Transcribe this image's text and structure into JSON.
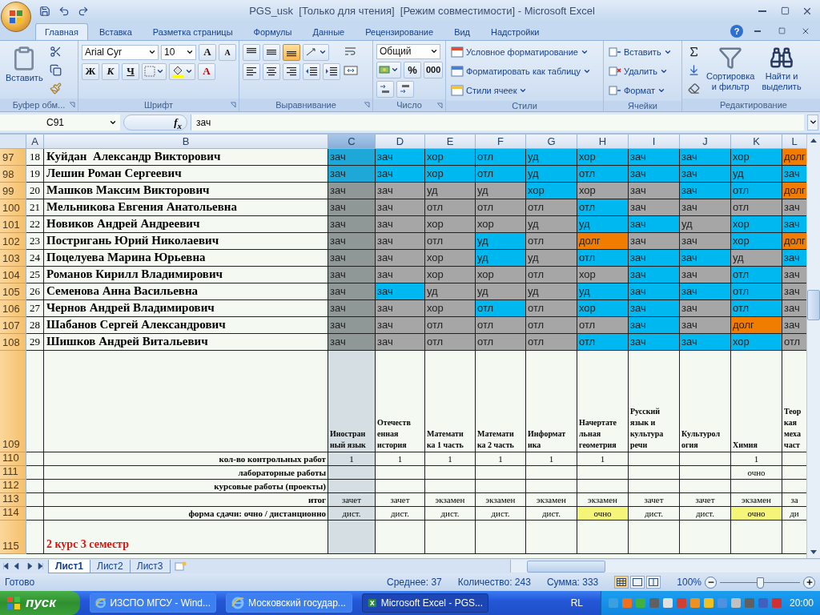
{
  "window": {
    "title": "PGS_usk  [Только для чтения]  [Режим совместимости] - Microsoft Excel",
    "help": "?"
  },
  "ribbon_tabs": [
    {
      "label": "Главная",
      "selected": true
    },
    {
      "label": "Вставка",
      "selected": false
    },
    {
      "label": "Разметка страницы",
      "selected": false
    },
    {
      "label": "Формулы",
      "selected": false
    },
    {
      "label": "Данные",
      "selected": false
    },
    {
      "label": "Рецензирование",
      "selected": false
    },
    {
      "label": "Вид",
      "selected": false
    },
    {
      "label": "Надстройки",
      "selected": false
    }
  ],
  "clipboard": {
    "paste": "Вставить",
    "group": "Буфер обм..."
  },
  "font": {
    "name": "Arial Cyr",
    "size": "10",
    "grow": "A",
    "shrink": "A",
    "bold": "Ж",
    "italic": "К",
    "underline": "Ч",
    "color_letter": "A",
    "group": "Шрифт"
  },
  "alignment": {
    "vertical": [
      {
        "selected": false
      },
      {
        "selected": false
      },
      {
        "selected": true
      }
    ],
    "group": "Выравнивание"
  },
  "number": {
    "format": "Общий",
    "percent": "%",
    "thousands": "000",
    "group": "Число"
  },
  "styles": {
    "items": [
      "Условное форматирование",
      "Форматировать как таблицу",
      "Стили ячеек"
    ],
    "group": "Стили"
  },
  "cells": {
    "items": [
      "Вставить",
      "Удалить",
      "Формат"
    ],
    "group": "Ячейки"
  },
  "editing": {
    "sort": "Сортировка\nи фильтр",
    "find": "Найти и\nвыделить",
    "group": "Редактирование"
  },
  "formula_bar": {
    "name_box": "C91",
    "fx": "f$_{x}$",
    "formula": "зач"
  },
  "columns": [
    {
      "label": "A",
      "selected": false
    },
    {
      "label": "B",
      "selected": false
    },
    {
      "label": "C",
      "selected": true
    },
    {
      "label": "D",
      "selected": false
    },
    {
      "label": "E",
      "selected": false
    },
    {
      "label": "F",
      "selected": false
    },
    {
      "label": "G",
      "selected": false
    },
    {
      "label": "H",
      "selected": false
    },
    {
      "label": "I",
      "selected": false
    },
    {
      "label": "J",
      "selected": false
    },
    {
      "label": "K",
      "selected": false
    },
    {
      "label": "L",
      "selected": false
    }
  ],
  "student_rows": [
    {
      "row": "97",
      "num": "18",
      "name": "Куйдан  Александр Викторович",
      "cells": [
        {
          "text": "зач",
          "color": "#1ea8d8"
        },
        {
          "text": "зач",
          "color": "#00b8f0"
        },
        {
          "text": "хор",
          "color": "#00b8f0"
        },
        {
          "text": "отл",
          "color": "#00b8f0"
        },
        {
          "text": "уд",
          "color": "#00b8f0"
        },
        {
          "text": "хор",
          "color": "#00b8f0"
        },
        {
          "text": "зач",
          "color": "#00b8f0"
        },
        {
          "text": "зач",
          "color": "#00b8f0"
        },
        {
          "text": "хор",
          "color": "#00b8f0"
        },
        {
          "text": "долг",
          "color": "#f07c00"
        }
      ]
    },
    {
      "row": "98",
      "num": "19",
      "name": "Лешин Роман Сергеевич",
      "cells": [
        {
          "text": "зач",
          "color": "#1ea8d8"
        },
        {
          "text": "зач",
          "color": "#00b8f0"
        },
        {
          "text": "хор",
          "color": "#00b8f0"
        },
        {
          "text": "отл",
          "color": "#00b8f0"
        },
        {
          "text": "уд",
          "color": "#00b8f0"
        },
        {
          "text": "отл",
          "color": "#00b8f0"
        },
        {
          "text": "зач",
          "color": "#00b8f0"
        },
        {
          "text": "зач",
          "color": "#00b8f0"
        },
        {
          "text": "уд",
          "color": "#00b8f0"
        },
        {
          "text": "зач",
          "color": "#00b8f0"
        }
      ]
    },
    {
      "row": "99",
      "num": "20",
      "name": "Машков Максим Викторович",
      "cells": [
        {
          "text": "зач",
          "color": "#8f9797"
        },
        {
          "text": "зач",
          "color": "#a6a6a6"
        },
        {
          "text": "уд",
          "color": "#a6a6a6"
        },
        {
          "text": "уд",
          "color": "#a6a6a6"
        },
        {
          "text": "хор",
          "color": "#00b8f0"
        },
        {
          "text": "хор",
          "color": "#a6a6a6"
        },
        {
          "text": "зач",
          "color": "#a6a6a6"
        },
        {
          "text": "зач",
          "color": "#00b8f0"
        },
        {
          "text": "отл",
          "color": "#00b8f0"
        },
        {
          "text": "долг",
          "color": "#f07c00"
        }
      ]
    },
    {
      "row": "100",
      "num": "21",
      "name": "Мельникова Евгения Анатольевна",
      "cells": [
        {
          "text": "зач",
          "color": "#8f9797"
        },
        {
          "text": "зач",
          "color": "#a6a6a6"
        },
        {
          "text": "отл",
          "color": "#a6a6a6"
        },
        {
          "text": "отл",
          "color": "#a6a6a6"
        },
        {
          "text": "отл",
          "color": "#a6a6a6"
        },
        {
          "text": "отл",
          "color": "#00b8f0"
        },
        {
          "text": "зач",
          "color": "#a6a6a6"
        },
        {
          "text": "зач",
          "color": "#a6a6a6"
        },
        {
          "text": "отл",
          "color": "#a6a6a6"
        },
        {
          "text": "зач",
          "color": "#a6a6a6"
        }
      ]
    },
    {
      "row": "101",
      "num": "22",
      "name": "Новиков Андрей Андреевич",
      "cells": [
        {
          "text": "зач",
          "color": "#8f9797"
        },
        {
          "text": "зач",
          "color": "#a6a6a6"
        },
        {
          "text": "хор",
          "color": "#a6a6a6"
        },
        {
          "text": "хор",
          "color": "#a6a6a6"
        },
        {
          "text": "уд",
          "color": "#a6a6a6"
        },
        {
          "text": "уд",
          "color": "#00b8f0"
        },
        {
          "text": "зач",
          "color": "#00b8f0"
        },
        {
          "text": "уд",
          "color": "#a6a6a6"
        },
        {
          "text": "хор",
          "color": "#00b8f0"
        },
        {
          "text": "зач",
          "color": "#00b8f0"
        }
      ]
    },
    {
      "row": "102",
      "num": "23",
      "name": "Постригань Юрий Николаевич",
      "cells": [
        {
          "text": "зач",
          "color": "#8f9797"
        },
        {
          "text": "зач",
          "color": "#a6a6a6"
        },
        {
          "text": "отл",
          "color": "#a6a6a6"
        },
        {
          "text": "уд",
          "color": "#00b8f0"
        },
        {
          "text": "отл",
          "color": "#a6a6a6"
        },
        {
          "text": "долг",
          "color": "#f07c00"
        },
        {
          "text": "зач",
          "color": "#a6a6a6"
        },
        {
          "text": "зач",
          "color": "#a6a6a6"
        },
        {
          "text": "хор",
          "color": "#00b8f0"
        },
        {
          "text": "долг",
          "color": "#f07c00"
        }
      ]
    },
    {
      "row": "103",
      "num": "24",
      "name": "Поцелуева Марина Юрьевна",
      "cells": [
        {
          "text": "зач",
          "color": "#8f9797"
        },
        {
          "text": "зач",
          "color": "#a6a6a6"
        },
        {
          "text": "хор",
          "color": "#a6a6a6"
        },
        {
          "text": "уд",
          "color": "#00b8f0"
        },
        {
          "text": "уд",
          "color": "#a6a6a6"
        },
        {
          "text": "отл",
          "color": "#00b8f0"
        },
        {
          "text": "зач",
          "color": "#00b8f0"
        },
        {
          "text": "зач",
          "color": "#00b8f0"
        },
        {
          "text": "уд",
          "color": "#a6a6a6"
        },
        {
          "text": "зач",
          "color": "#00b8f0"
        }
      ]
    },
    {
      "row": "104",
      "num": "25",
      "name": "Романов Кирилл Владимирович",
      "cells": [
        {
          "text": "зач",
          "color": "#8f9797"
        },
        {
          "text": "зач",
          "color": "#a6a6a6"
        },
        {
          "text": "хор",
          "color": "#a6a6a6"
        },
        {
          "text": "хор",
          "color": "#a6a6a6"
        },
        {
          "text": "отл",
          "color": "#a6a6a6"
        },
        {
          "text": "хор",
          "color": "#a6a6a6"
        },
        {
          "text": "зач",
          "color": "#00b8f0"
        },
        {
          "text": "зач",
          "color": "#a6a6a6"
        },
        {
          "text": "отл",
          "color": "#00b8f0"
        },
        {
          "text": "зач",
          "color": "#a6a6a6"
        }
      ]
    },
    {
      "row": "105",
      "num": "26",
      "name": "Семенова Анна Васильевна",
      "cells": [
        {
          "text": "зач",
          "color": "#8f9797"
        },
        {
          "text": "зач",
          "color": "#00b8f0"
        },
        {
          "text": "уд",
          "color": "#a6a6a6"
        },
        {
          "text": "уд",
          "color": "#a6a6a6"
        },
        {
          "text": "уд",
          "color": "#a6a6a6"
        },
        {
          "text": "уд",
          "color": "#00b8f0"
        },
        {
          "text": "зач",
          "color": "#00b8f0"
        },
        {
          "text": "зач",
          "color": "#00b8f0"
        },
        {
          "text": "отл",
          "color": "#00b8f0"
        },
        {
          "text": "зач",
          "color": "#a6a6a6"
        }
      ]
    },
    {
      "row": "106",
      "num": "27",
      "name": "Чернов Андрей Владимирович",
      "cells": [
        {
          "text": "зач",
          "color": "#8f9797"
        },
        {
          "text": "зач",
          "color": "#a6a6a6"
        },
        {
          "text": "хор",
          "color": "#a6a6a6"
        },
        {
          "text": "отл",
          "color": "#00b8f0"
        },
        {
          "text": "отл",
          "color": "#a6a6a6"
        },
        {
          "text": "хор",
          "color": "#00b8f0"
        },
        {
          "text": "зач",
          "color": "#00b8f0"
        },
        {
          "text": "зач",
          "color": "#a6a6a6"
        },
        {
          "text": "отл",
          "color": "#00b8f0"
        },
        {
          "text": "зач",
          "color": "#a6a6a6"
        }
      ]
    },
    {
      "row": "107",
      "num": "28",
      "name": "Шабанов Сергей Александрович",
      "cells": [
        {
          "text": "зач",
          "color": "#8f9797"
        },
        {
          "text": "зач",
          "color": "#a6a6a6"
        },
        {
          "text": "отл",
          "color": "#a6a6a6"
        },
        {
          "text": "отл",
          "color": "#a6a6a6"
        },
        {
          "text": "отл",
          "color": "#a6a6a6"
        },
        {
          "text": "отл",
          "color": "#a6a6a6"
        },
        {
          "text": "зач",
          "color": "#00b8f0"
        },
        {
          "text": "зач",
          "color": "#a6a6a6"
        },
        {
          "text": "долг",
          "color": "#f07c00"
        },
        {
          "text": "зач",
          "color": "#a6a6a6"
        }
      ]
    },
    {
      "row": "108",
      "num": "29",
      "name": "Шишков Андрей Витальевич",
      "cells": [
        {
          "text": "зач",
          "color": "#8f9797"
        },
        {
          "text": "зач",
          "color": "#a6a6a6"
        },
        {
          "text": "отл",
          "color": "#a6a6a6"
        },
        {
          "text": "отл",
          "color": "#a6a6a6"
        },
        {
          "text": "отл",
          "color": "#a6a6a6"
        },
        {
          "text": "отл",
          "color": "#00b8f0"
        },
        {
          "text": "зач",
          "color": "#00b8f0"
        },
        {
          "text": "зач",
          "color": "#00b8f0"
        },
        {
          "text": "хор",
          "color": "#00b8f0"
        },
        {
          "text": "отл",
          "color": "#a6a6a6"
        }
      ]
    }
  ],
  "subject_row": {
    "row": "109",
    "subjects": [
      "Иностран\nный язык",
      "Отечеств\nенная\nистория",
      "Математи\nка 1 часть",
      "Математи\nка 2 часть",
      "Информат\nика",
      "Начертате\nльная\nгеометрия",
      "Русский\nязык и\nкультура\nречи",
      "Культурол\nогия",
      "Химия",
      "Теор\nкая\nмеха\nчаст"
    ]
  },
  "summary_rows": [
    {
      "row": "110",
      "label": "кол-во контрольных работ",
      "values": [
        {
          "kind": "text",
          "text": "1"
        },
        {
          "kind": "text",
          "text": "1"
        },
        {
          "kind": "text",
          "text": "1"
        },
        {
          "kind": "text",
          "text": "1"
        },
        {
          "kind": "text",
          "text": "1"
        },
        {
          "kind": "text",
          "text": "1"
        },
        {
          "kind": "blank"
        },
        {
          "kind": "blank"
        },
        {
          "kind": "text",
          "text": "1"
        },
        {
          "kind": "blank"
        }
      ]
    },
    {
      "row": "111",
      "label": "лабораторные работы",
      "values": [
        {
          "kind": "blank"
        },
        {
          "kind": "blank"
        },
        {
          "kind": "blank"
        },
        {
          "kind": "blank"
        },
        {
          "kind": "blank"
        },
        {
          "kind": "blank"
        },
        {
          "kind": "blank"
        },
        {
          "kind": "blank"
        },
        {
          "kind": "text",
          "text": "очно"
        },
        {
          "kind": "blank"
        }
      ]
    },
    {
      "row": "112",
      "label": "курсовые работы (проекты)"
    },
    {
      "row": "113",
      "label": "итог",
      "values": [
        {
          "kind": "text",
          "text": "зачет"
        },
        {
          "kind": "text",
          "text": "зачет"
        },
        {
          "kind": "text",
          "text": "экзамен"
        },
        {
          "kind": "text",
          "text": "экзамен"
        },
        {
          "kind": "text",
          "text": "экзамен"
        },
        {
          "kind": "text",
          "text": "экзамен"
        },
        {
          "kind": "text",
          "text": "зачет"
        },
        {
          "kind": "text",
          "text": "зачет"
        },
        {
          "kind": "text",
          "text": "экзамен"
        },
        {
          "kind": "text",
          "text": "за"
        }
      ]
    },
    {
      "row": "114",
      "label": "форма сдачи: очно / дистанционно",
      "values": [
        {
          "kind": "text",
          "text": "дист.",
          "highlighted": false
        },
        {
          "kind": "text",
          "text": "дист.",
          "highlighted": false
        },
        {
          "kind": "text",
          "text": "дист.",
          "highlighted": false
        },
        {
          "kind": "text",
          "text": "дист.",
          "highlighted": false
        },
        {
          "kind": "text",
          "text": "дист.",
          "highlighted": false
        },
        {
          "kind": "text",
          "text": "очно",
          "highlighted": true
        },
        {
          "kind": "text",
          "text": "дист.",
          "highlighted": false
        },
        {
          "kind": "text",
          "text": "дист.",
          "highlighted": false
        },
        {
          "kind": "text",
          "text": "очно",
          "highlighted": true
        },
        {
          "kind": "text",
          "text": "ди",
          "highlighted": false
        }
      ]
    }
  ],
  "section_row": {
    "row": "115",
    "title": "2 курс 3 семестр"
  },
  "sheet_tabs": [
    {
      "label": "Лист1",
      "selected": true
    },
    {
      "label": "Лист2",
      "selected": false
    },
    {
      "label": "Лист3",
      "selected": false
    }
  ],
  "status_bar": {
    "state": "Готово",
    "average": "Среднее: 37",
    "count": "Количество: 243",
    "sum": "Сумма: 333",
    "zoom": "100%",
    "zoom_level": {
      "level": 0.5
    }
  },
  "taskbar": {
    "start": "пуск",
    "tasks": [
      {
        "label": "ИЗСПО МГСУ - Wind...",
        "kind": "browser",
        "selected": false
      },
      {
        "label": "Московский государ...",
        "kind": "browser",
        "selected": false
      },
      {
        "label": "Microsoft Excel - PGS...",
        "kind": "excel",
        "selected": true
      }
    ],
    "language": "RL",
    "clock": "20:00"
  }
}
